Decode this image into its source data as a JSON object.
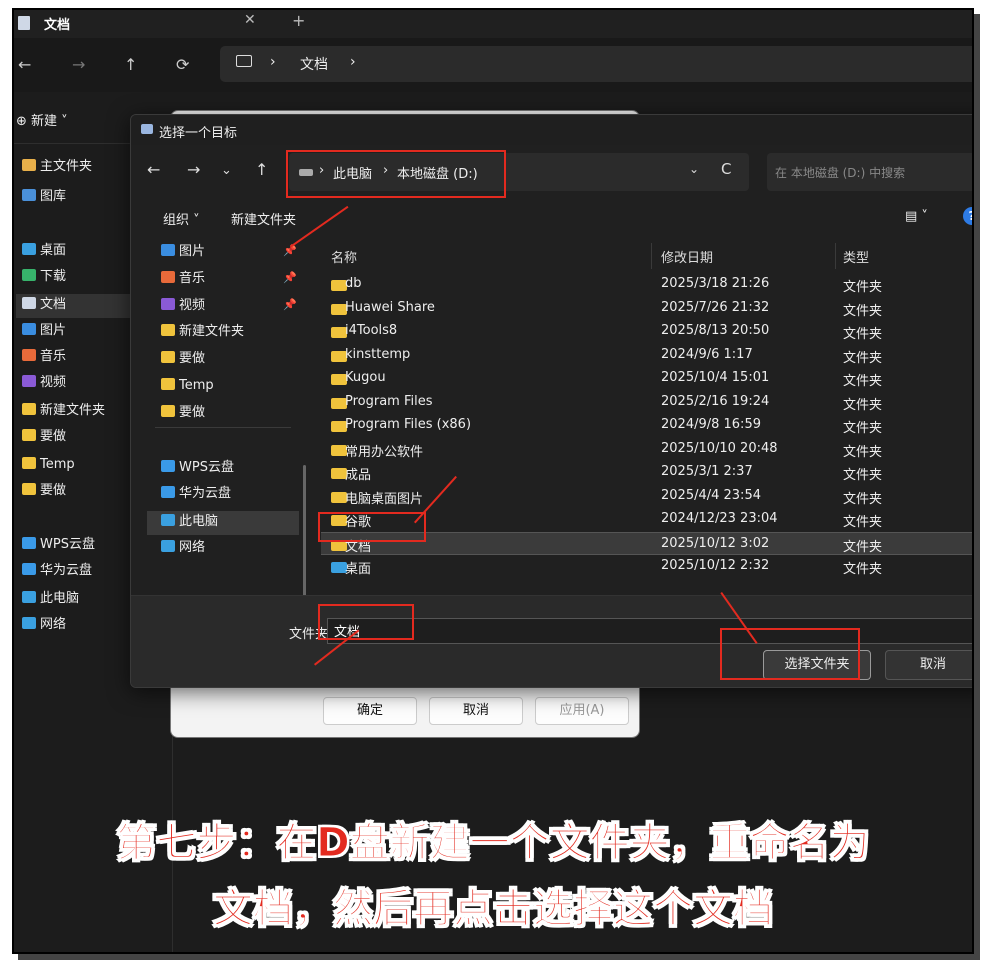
{
  "explorer": {
    "tab_title": "文档",
    "tab_close": "✕",
    "tab_add": "+",
    "nav": {
      "back": "←",
      "forward": "→",
      "up": "↑",
      "refresh": "⟳"
    },
    "breadcrumb": [
      "›",
      "文档",
      "›"
    ],
    "new_label": "⊕ 新建 ˅",
    "sidebar": [
      {
        "label": "主文件夹",
        "icon": "home-icon",
        "color": "#e8b04a"
      },
      {
        "label": "图库",
        "icon": "gallery-icon",
        "color": "#4a90d9"
      },
      {
        "label": "桌面",
        "icon": "desktop-icon",
        "color": "#3aa0e0"
      },
      {
        "label": "下载",
        "icon": "download-icon",
        "color": "#37b36b"
      },
      {
        "label": "文档",
        "icon": "document-icon",
        "color": "#cfd8e6"
      },
      {
        "label": "图片",
        "icon": "pictures-icon",
        "color": "#3a8de0"
      },
      {
        "label": "音乐",
        "icon": "music-icon",
        "color": "#e86a3a"
      },
      {
        "label": "视频",
        "icon": "video-icon",
        "color": "#8a5ad6"
      },
      {
        "label": "新建文件夹",
        "icon": "folder-icon",
        "color": "#f0c33c"
      },
      {
        "label": "要做",
        "icon": "folder-icon",
        "color": "#f0c33c"
      },
      {
        "label": "Temp",
        "icon": "folder-icon",
        "color": "#f0c33c"
      },
      {
        "label": "要做",
        "icon": "folder-icon",
        "color": "#f0c33c"
      },
      {
        "label": "WPS云盘",
        "icon": "cloud-icon",
        "color": "#3a9ae8"
      },
      {
        "label": "华为云盘",
        "icon": "cloud-icon",
        "color": "#3a9ae8"
      },
      {
        "label": "此电脑",
        "icon": "computer-icon",
        "color": "#3aa0e0"
      },
      {
        "label": "网络",
        "icon": "network-icon",
        "color": "#3aa0e0"
      }
    ]
  },
  "properties": {
    "ok": "确定",
    "cancel": "取消",
    "apply": "应用(A)"
  },
  "dialog": {
    "title": "选择一个目标",
    "close": "✕",
    "nav": {
      "back": "←",
      "forward": "→",
      "recent": "⌄",
      "up": "↑"
    },
    "address": {
      "sep1": "›",
      "crumb1": "此电脑",
      "sep2": "›",
      "crumb2": "本地磁盘 (D:)",
      "chevron": "⌄",
      "refresh": "C"
    },
    "search_placeholder": "在 本地磁盘 (D:) 中搜索",
    "search_icon": "⌕",
    "organize": "组织 ˅",
    "new_folder": "新建文件夹",
    "view_icon": "▤ ˅",
    "help": "?",
    "nav_pane": [
      {
        "label": "图片",
        "icon": "pictures-icon",
        "color": "#3a8de0",
        "pinned": true
      },
      {
        "label": "音乐",
        "icon": "music-icon",
        "color": "#e86a3a",
        "pinned": true
      },
      {
        "label": "视频",
        "icon": "video-icon",
        "color": "#8a5ad6",
        "pinned": true
      },
      {
        "label": "新建文件夹",
        "icon": "folder-icon",
        "color": "#f0c33c",
        "pinned": false
      },
      {
        "label": "要做",
        "icon": "folder-icon",
        "color": "#f0c33c",
        "pinned": false
      },
      {
        "label": "Temp",
        "icon": "folder-icon",
        "color": "#f0c33c",
        "pinned": false
      },
      {
        "label": "要做",
        "icon": "folder-icon",
        "color": "#f0c33c",
        "pinned": false
      },
      {
        "label": "WPS云盘",
        "icon": "cloud-icon",
        "color": "#3a9ae8",
        "pinned": false
      },
      {
        "label": "华为云盘",
        "icon": "cloud-icon",
        "color": "#3a9ae8",
        "pinned": false
      },
      {
        "label": "此电脑",
        "icon": "computer-icon",
        "color": "#3aa0e0",
        "pinned": false
      },
      {
        "label": "网络",
        "icon": "network-icon",
        "color": "#3aa0e0",
        "pinned": false
      }
    ],
    "pin_glyph": "📌",
    "columns": {
      "name": "名称",
      "date": "修改日期",
      "type": "类型"
    },
    "files": [
      {
        "name": "db",
        "date": "2025/3/18 21:26",
        "type": "文件夹"
      },
      {
        "name": "Huawei Share",
        "date": "2025/7/26 21:32",
        "type": "文件夹"
      },
      {
        "name": "i4Tools8",
        "date": "2025/8/13 20:50",
        "type": "文件夹"
      },
      {
        "name": "kinsttemp",
        "date": "2024/9/6 1:17",
        "type": "文件夹"
      },
      {
        "name": "Kugou",
        "date": "2025/10/4 15:01",
        "type": "文件夹"
      },
      {
        "name": "Program Files",
        "date": "2025/2/16 19:24",
        "type": "文件夹"
      },
      {
        "name": "Program Files (x86)",
        "date": "2024/9/8 16:59",
        "type": "文件夹"
      },
      {
        "name": "常用办公软件",
        "date": "2025/10/10 20:48",
        "type": "文件夹"
      },
      {
        "name": "成品",
        "date": "2025/3/1 2:37",
        "type": "文件夹"
      },
      {
        "name": "电脑桌面图片",
        "date": "2025/4/4 23:54",
        "type": "文件夹"
      },
      {
        "name": "谷歌",
        "date": "2024/12/23 23:04",
        "type": "文件夹"
      },
      {
        "name": "文档",
        "date": "2025/10/12 3:02",
        "type": "文件夹"
      },
      {
        "name": "桌面",
        "date": "2025/10/12 2:32",
        "type": "文件夹"
      }
    ],
    "folder_label": "文件夹:",
    "folder_value": "文档",
    "select_button": "选择文件夹",
    "cancel_button": "取消"
  },
  "annotation_color": "#e32a1f",
  "caption": {
    "line1": "第七步：在D盘新建一个文件夹，重命名为",
    "line2": "文档，然后再点击选择这个文档"
  }
}
